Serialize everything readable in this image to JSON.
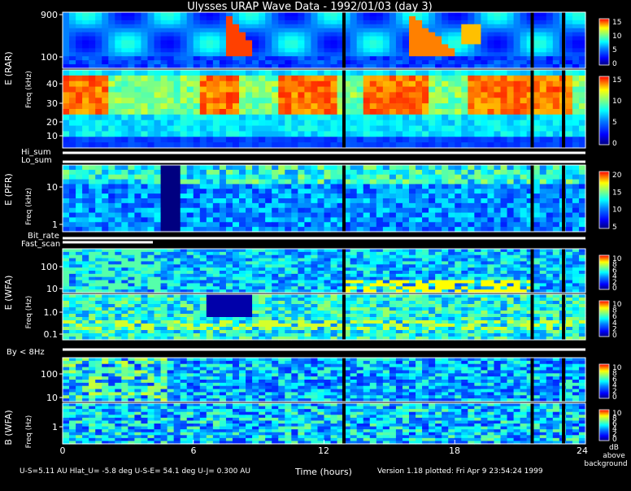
{
  "title": "Ulysses URAP Wave Data - 1992/01/03  (day 3)",
  "xaxis": {
    "label": "Time (hours)",
    "ticks": [
      "0",
      "6",
      "12",
      "18",
      "24"
    ]
  },
  "footer": {
    "left": "U-S=5.11 AU  Hlat_U= -5.8 deg  U-S-E= 54.1 deg  U-J= 0.300 AU",
    "right": "Version 1.18 plotted: Fri Apr  9 23:54:24 1999",
    "unit_lines": [
      "dB",
      "above",
      "background"
    ]
  },
  "indicators": {
    "hi_sum": "Hi_sum",
    "lo_sum": "Lo_sum",
    "bit_rate": "Bit_rate",
    "fast_scan": "Fast_scan",
    "by": "By < 8Hz"
  },
  "panels": [
    {
      "id": "rar-high",
      "ylabel": "",
      "yunit": "",
      "ticks": [
        "900",
        "100"
      ],
      "cbar_ticks": [
        "15",
        "10",
        "5",
        "0"
      ]
    },
    {
      "id": "rar-low",
      "ylabel": "E (RAR)",
      "yunit": "Freq (kHz)",
      "ticks": [
        "40",
        "30",
        "20",
        "10"
      ],
      "cbar_ticks": [
        "15",
        "10",
        "5",
        "0"
      ]
    },
    {
      "id": "pfr",
      "ylabel": "E (PFR)",
      "yunit": "Freq (kHz)",
      "ticks": [
        "10",
        "1"
      ],
      "cbar_ticks": [
        "20",
        "15",
        "10",
        "5"
      ]
    },
    {
      "id": "wfa-e-high",
      "ylabel": "",
      "yunit": "",
      "ticks": [
        "100",
        "10"
      ],
      "cbar_ticks": [
        "10",
        "8",
        "6",
        "4",
        "2",
        "0"
      ]
    },
    {
      "id": "wfa-e-low",
      "ylabel": "E (WFA)",
      "yunit": "Freq (Hz)",
      "ticks": [
        "1.0",
        "0.1"
      ],
      "cbar_ticks": [
        "10",
        "8",
        "6",
        "4",
        "2",
        "0"
      ]
    },
    {
      "id": "wfa-b-high",
      "ylabel": "",
      "yunit": "",
      "ticks": [
        "100",
        "10"
      ],
      "cbar_ticks": [
        "10",
        "8",
        "6",
        "4",
        "2",
        "0"
      ]
    },
    {
      "id": "wfa-b-low",
      "ylabel": "B (WFA)",
      "yunit": "Freq (Hz)",
      "ticks": [
        "1"
      ],
      "cbar_ticks": [
        "10",
        "8",
        "6",
        "4",
        "2",
        "0"
      ]
    }
  ],
  "colors": {
    "low": "#00007a",
    "mid": "#00ffff",
    "high": "#ffff00",
    "max": "#ff0000"
  },
  "chart_data": {
    "type": "heatmap",
    "x_unit": "hours",
    "xlim": [
      0,
      24
    ],
    "time_ticks": [
      0,
      6,
      12,
      18,
      24
    ],
    "panels": [
      {
        "name": "E (RAR) high band",
        "freq_unit": "kHz",
        "freq_ticks": [
          100,
          900
        ],
        "scale": "log",
        "zlim": [
          0,
          15
        ]
      },
      {
        "name": "E (RAR) low band",
        "freq_unit": "kHz",
        "freq_ticks": [
          10,
          20,
          30,
          40
        ],
        "scale": "linear",
        "zlim": [
          0,
          15
        ]
      },
      {
        "name": "E (PFR)",
        "freq_unit": "kHz",
        "freq_ticks": [
          1,
          10
        ],
        "scale": "log",
        "zlim": [
          5,
          20
        ]
      },
      {
        "name": "E (WFA) high band",
        "freq_unit": "Hz",
        "freq_ticks": [
          10,
          100
        ],
        "scale": "log",
        "zlim": [
          0,
          10
        ]
      },
      {
        "name": "E (WFA) low band",
        "freq_unit": "Hz",
        "freq_ticks": [
          0.1,
          1.0
        ],
        "scale": "log",
        "zlim": [
          0,
          10
        ]
      },
      {
        "name": "B (WFA) high band",
        "freq_unit": "Hz",
        "freq_ticks": [
          10,
          100
        ],
        "scale": "log",
        "zlim": [
          0,
          10
        ]
      },
      {
        "name": "B (WFA) low band",
        "freq_unit": "Hz",
        "freq_ticks": [
          1
        ],
        "scale": "log",
        "zlim": [
          0,
          10
        ]
      }
    ],
    "colorbar_unit": "dB above background"
  }
}
